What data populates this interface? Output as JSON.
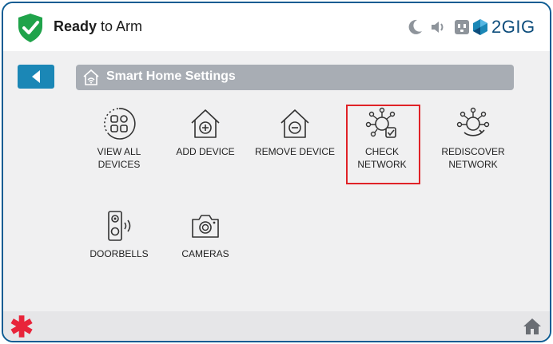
{
  "header": {
    "status_strong": "Ready",
    "status_rest": " to Arm",
    "brand_text": "2GIG",
    "icons": [
      "shield-check-icon",
      "moon-icon",
      "speaker-icon",
      "outlet-icon",
      "brand-logo-icon"
    ]
  },
  "titlebar": {
    "title": "Smart Home Settings"
  },
  "tiles": [
    {
      "line1": "VIEW ALL",
      "line2": "DEVICES",
      "icon": "view-all-devices-icon"
    },
    {
      "line1": "ADD DEVICE",
      "line2": "",
      "icon": "add-device-icon"
    },
    {
      "line1": "REMOVE DEVICE",
      "line2": "",
      "icon": "remove-device-icon"
    },
    {
      "line1": "CHECK",
      "line2": "NETWORK",
      "icon": "check-network-icon"
    },
    {
      "line1": "REDISCOVER",
      "line2": "NETWORK",
      "icon": "rediscover-network-icon"
    },
    {
      "line1": "DOORBELLS",
      "line2": "",
      "icon": "doorbell-icon"
    },
    {
      "line1": "CAMERAS",
      "line2": "",
      "icon": "camera-icon"
    }
  ],
  "footer": {
    "asterisk": "✱",
    "icons": [
      "asterisk-icon",
      "home-icon"
    ]
  },
  "colors": {
    "frame": "#0d5c93",
    "back_button": "#1b87b6",
    "titlebar": "#a8adb4",
    "shield": "#1fa34a",
    "highlight": "#e02227",
    "asterisk": "#e8243a"
  }
}
